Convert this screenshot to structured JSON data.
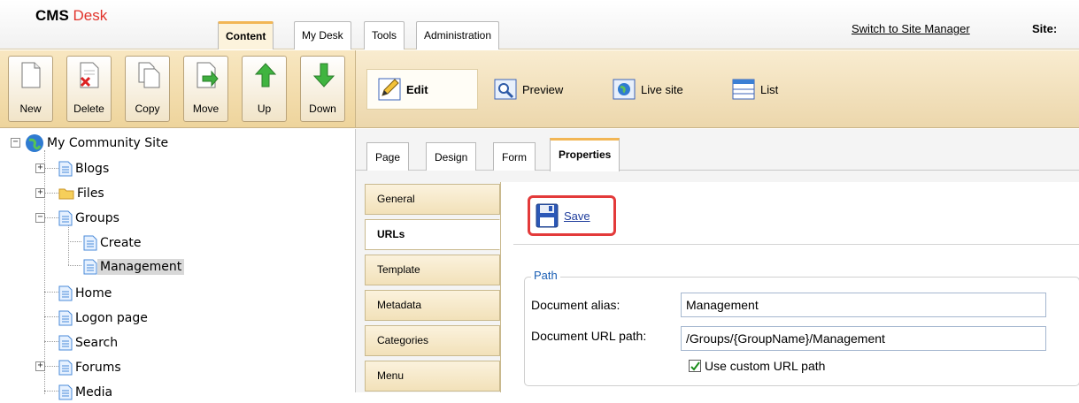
{
  "header": {
    "logo_cms": "CMS",
    "logo_desk": "Desk",
    "tabs": [
      "Content",
      "My Desk",
      "Tools",
      "Administration"
    ],
    "active_tab": "Content",
    "switch_link": "Switch to Site Manager",
    "site_label": "Site:"
  },
  "toolbar": {
    "buttons": [
      "New",
      "Delete",
      "Copy",
      "Move",
      "Up",
      "Down"
    ]
  },
  "view_toolbar": {
    "edit": "Edit",
    "preview": "Preview",
    "live_site": "Live site",
    "list": "List"
  },
  "tree": {
    "root": "My Community Site",
    "items": [
      "Blogs",
      "Files",
      "Groups",
      "Create",
      "Management",
      "Home",
      "Logon page",
      "Search",
      "Forums",
      "Media"
    ],
    "selected": "Management"
  },
  "page_tabs": [
    "Page",
    "Design",
    "Form",
    "Properties"
  ],
  "active_page_tab": "Properties",
  "property_tabs": [
    "General",
    "URLs",
    "Template",
    "Metadata",
    "Categories",
    "Menu"
  ],
  "active_property_tab": "URLs",
  "form": {
    "save_label": "Save",
    "legend": "Path",
    "alias_label": "Document alias:",
    "alias_value": "Management",
    "url_path_label": "Document URL path:",
    "url_path_value": "/Groups/{GroupName}/Management",
    "custom_path_label": "Use custom URL path",
    "custom_path_checked": true
  },
  "colors": {
    "accent_tab": "#f2b655",
    "toolbar": "#eed49c",
    "save_highlight": "#e33a3a",
    "link": "#1f3d9c"
  }
}
